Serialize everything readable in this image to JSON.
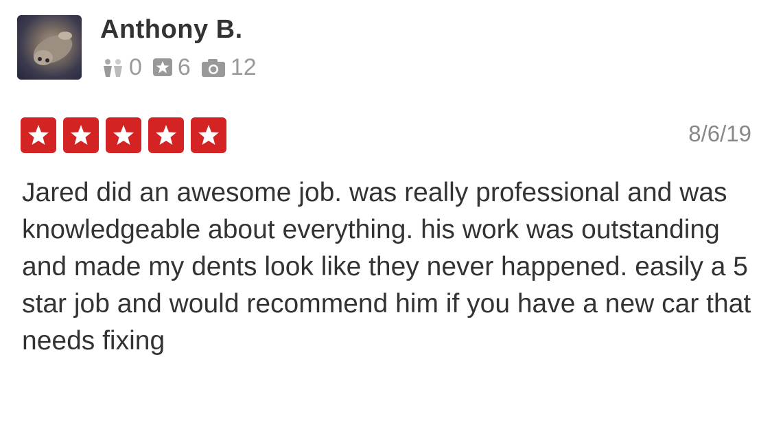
{
  "user": {
    "name": "Anthony B.",
    "friends_count": "0",
    "reviews_count": "6",
    "photos_count": "12",
    "avatar_icon": "user-avatar-photo"
  },
  "review": {
    "rating": 5,
    "rating_max": 5,
    "star_color": "#d32323",
    "date": "8/6/19",
    "text": "Jared did an awesome job. was really professional and was knowledgeable about everything. his work was outstanding and made my dents look like they never happened. easily a 5 star job and would recommend him if you have a new car that needs fixing"
  }
}
